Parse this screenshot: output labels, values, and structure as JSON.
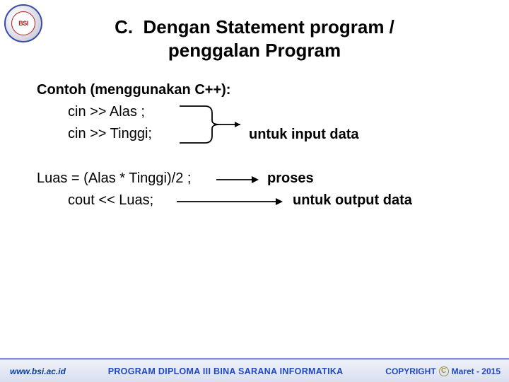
{
  "logo": {
    "text": "BSI"
  },
  "title": {
    "prefix": "C.",
    "line1": "Dengan Statement program /",
    "line2": "penggalan Program"
  },
  "content": {
    "subtitle": "Contoh (menggunakan C++):",
    "code1": "cin >> Alas ;",
    "code2": "cin >> Tinggi;",
    "annot_input": "untuk input data",
    "proc_line": "Luas = (Alas * Tinggi)/2 ;",
    "annot_proses": "proses",
    "out_line": "cout << Luas;",
    "annot_output": "untuk output data"
  },
  "footer": {
    "url": "www.bsi.ac.id",
    "program": "PROGRAM DIPLOMA III BINA SARANA INFORMATIKA",
    "copyright_label": "COPYRIGHT",
    "copyright_date": "Maret - 2015"
  }
}
